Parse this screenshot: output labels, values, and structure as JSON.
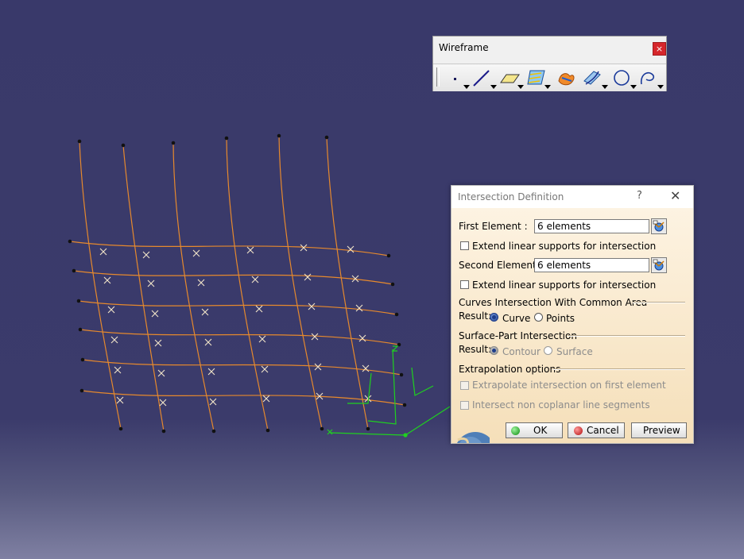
{
  "toolbar": {
    "title": "Wireframe",
    "close_label": "×",
    "tools": [
      "point-icon",
      "line-icon",
      "plane-icon",
      "projection-icon",
      "intersection-icon",
      "offset-curve-icon",
      "circle-icon",
      "spline-icon"
    ]
  },
  "dialog": {
    "title": "Intersection Definition",
    "help_label": "?",
    "close_label": "✕",
    "first_element": {
      "label": "First Element :",
      "value": "6 elements"
    },
    "extend_first": {
      "label": "Extend linear supports for intersection",
      "checked": false
    },
    "second_element": {
      "label": "Second Element :",
      "value": "6 elements"
    },
    "extend_second": {
      "label": "Extend linear supports for intersection",
      "checked": false
    },
    "curves_section": {
      "title": "Curves Intersection With Common Area",
      "result_label": "Result:",
      "options": [
        {
          "label": "Curve",
          "selected": true
        },
        {
          "label": "Points",
          "selected": false
        }
      ]
    },
    "surface_section": {
      "title": "Surface-Part Intersection",
      "result_label": "Result:",
      "options": [
        {
          "label": "Contour",
          "selected": true,
          "enabled": false
        },
        {
          "label": "Surface",
          "selected": false,
          "enabled": false
        }
      ]
    },
    "extrapolation_section": {
      "title": "Extrapolation options",
      "extrapolate": {
        "label": "Extrapolate intersection on first element",
        "enabled": false
      },
      "non_coplanar": {
        "label": "Intersect non coplanar line segments",
        "enabled": false
      }
    },
    "buttons": {
      "ok": "OK",
      "cancel": "Cancel",
      "preview": "Preview"
    }
  },
  "colors": {
    "background_top": "#39396a",
    "background_bottom": "#7f80a2",
    "curve": "#e6892d",
    "intersection_mark": "#f3e6c9",
    "axis": "#1fd11f",
    "dialog_body": "#f8e6c5"
  }
}
